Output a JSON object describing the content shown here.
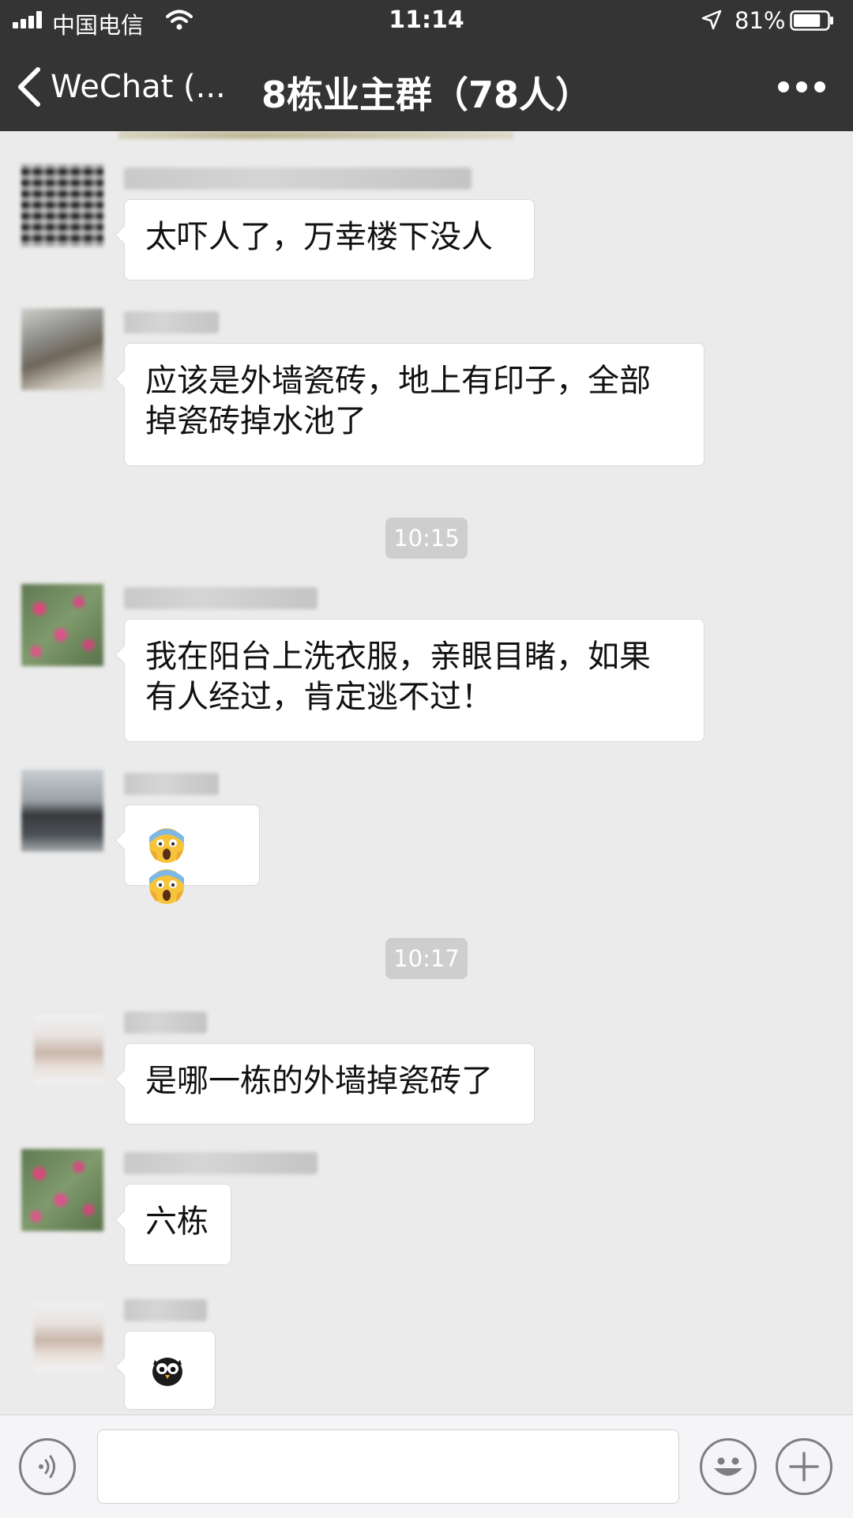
{
  "status_bar": {
    "carrier": "中国电信",
    "time": "11:14",
    "battery_percent": "81%",
    "battery_level": 0.81
  },
  "nav": {
    "back_label": "WeChat (...",
    "title": "8栋业主群（78人）",
    "more_icon": "more-dots-icon"
  },
  "messages": [
    {
      "avatar": "qr-code-avatar",
      "lines": [
        "太吓人了，万幸楼下没人"
      ]
    },
    {
      "avatar": "person-avatar",
      "lines": [
        "应该是外墙瓷砖，地上有印子，全部",
        "掉瓷砖掉水池了"
      ]
    },
    {
      "timestamp": "10:15"
    },
    {
      "avatar": "flowers-avatar",
      "lines": [
        "我在阳台上洗衣服，亲眼目睹，如果",
        "有人经过，肯定逃不过！"
      ]
    },
    {
      "avatar": "dark-person-avatar",
      "emoji": [
        "screaming-face-emoji",
        "screaming-face-emoji"
      ]
    },
    {
      "timestamp": "10:17"
    },
    {
      "avatar": "girl-avatar",
      "lines": [
        "是哪一栋的外墙掉瓷砖了"
      ]
    },
    {
      "avatar": "flowers-avatar",
      "lines": [
        "六栋"
      ]
    },
    {
      "avatar": "girl-avatar",
      "sticker": "owl-sticker"
    }
  ],
  "input_bar": {
    "voice_icon": "voice-icon",
    "text_value": "",
    "emoji_icon": "emoji-icon",
    "plus_icon": "plus-icon"
  },
  "colors": {
    "nav_background": "#343434",
    "chat_background": "#ebebeb",
    "timestamp_background": "#cecece",
    "bubble_background": "#ffffff"
  }
}
